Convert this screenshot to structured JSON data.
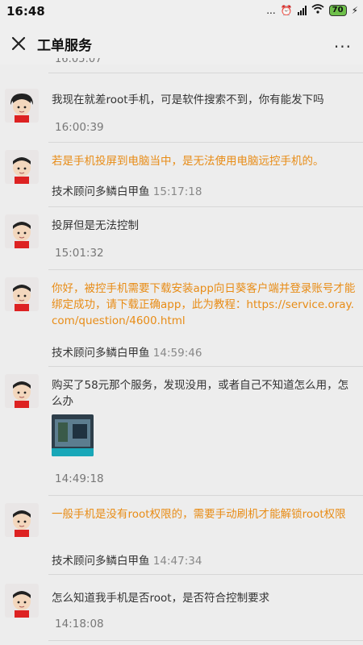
{
  "status": {
    "time": "16:48",
    "dots": "...",
    "battery": "70"
  },
  "header": {
    "title": "工单服务",
    "more": "..."
  },
  "top_time": "16:05:07",
  "messages": [
    {
      "text": "我现在就差root手机，可是软件搜索不到，你有能发下吗",
      "time": "16:00:39"
    },
    {
      "text": "若是手机投屏到电脑当中，是无法使用电脑远控手机的。",
      "sender": "技术顾问多鳞白甲鱼",
      "time": "15:17:18"
    },
    {
      "text": "投屏但是无法控制",
      "time": "15:01:32"
    },
    {
      "text": "你好，被控手机需要下载安装app向日葵客户端并登录账号才能绑定成功，请下载正确app，此为教程：https://service.oray.com/question/4600.html",
      "sender": "技术顾问多鳞白甲鱼",
      "time": "14:59:46"
    },
    {
      "text": "购买了58元那个服务，发现没用，或者自己不知道怎么用，怎么办",
      "time": "14:49:18"
    },
    {
      "text": "一般手机是没有root权限的，需要手动刷机才能解锁root权限",
      "sender": "技术顾问多鳞白甲鱼",
      "time": "14:47:34"
    },
    {
      "text": "怎么知道我手机是否root，是否符合控制要求",
      "time": "14:18:08"
    }
  ]
}
